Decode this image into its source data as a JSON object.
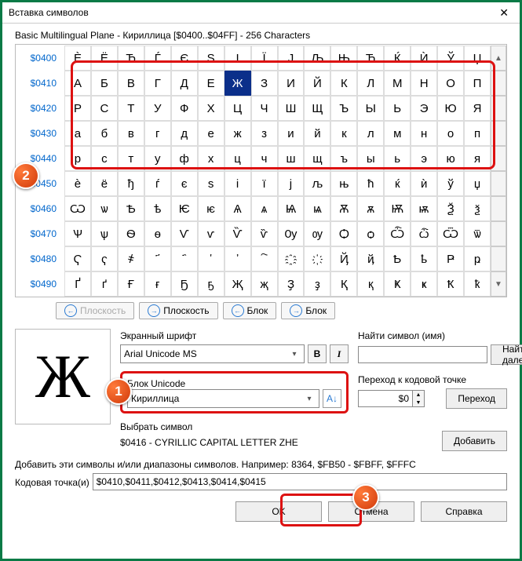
{
  "window": {
    "title": "Вставка символов"
  },
  "block_title": "Basic Multilingual Plane - Кириллица [$0400..$04FF] - 256 Characters",
  "rows": [
    {
      "label": "$0400",
      "chars": [
        "Ѐ",
        "Ё",
        "Ђ",
        "Ѓ",
        "Є",
        "Ѕ",
        "І",
        "Ї",
        "Ј",
        "Љ",
        "Њ",
        "Ћ",
        "Ќ",
        "Ѝ",
        "Ў",
        "Џ"
      ]
    },
    {
      "label": "$0410",
      "chars": [
        "А",
        "Б",
        "В",
        "Г",
        "Д",
        "Е",
        "Ж",
        "З",
        "И",
        "Й",
        "К",
        "Л",
        "М",
        "Н",
        "О",
        "П"
      ]
    },
    {
      "label": "$0420",
      "chars": [
        "Р",
        "С",
        "Т",
        "У",
        "Ф",
        "Х",
        "Ц",
        "Ч",
        "Ш",
        "Щ",
        "Ъ",
        "Ы",
        "Ь",
        "Э",
        "Ю",
        "Я"
      ]
    },
    {
      "label": "$0430",
      "chars": [
        "а",
        "б",
        "в",
        "г",
        "д",
        "е",
        "ж",
        "з",
        "и",
        "й",
        "к",
        "л",
        "м",
        "н",
        "о",
        "п"
      ]
    },
    {
      "label": "$0440",
      "chars": [
        "р",
        "с",
        "т",
        "у",
        "ф",
        "х",
        "ц",
        "ч",
        "ш",
        "щ",
        "ъ",
        "ы",
        "ь",
        "э",
        "ю",
        "я"
      ]
    },
    {
      "label": "$0450",
      "chars": [
        "ѐ",
        "ё",
        "ђ",
        "ѓ",
        "є",
        "ѕ",
        "і",
        "ї",
        "ј",
        "љ",
        "њ",
        "ћ",
        "ќ",
        "ѝ",
        "ў",
        "џ"
      ]
    },
    {
      "label": "$0460",
      "chars": [
        "Ѡ",
        "ѡ",
        "Ѣ",
        "ѣ",
        "Ѥ",
        "ѥ",
        "Ѧ",
        "ѧ",
        "Ѩ",
        "ѩ",
        "Ѫ",
        "ѫ",
        "Ѭ",
        "ѭ",
        "Ѯ",
        "ѯ"
      ]
    },
    {
      "label": "$0470",
      "chars": [
        "Ѱ",
        "ѱ",
        "Ѳ",
        "ѳ",
        "Ѵ",
        "ѵ",
        "Ѷ",
        "ѷ",
        "Ѹ",
        "ѹ",
        "Ѻ",
        "ѻ",
        "Ѽ",
        "ѽ",
        "Ѿ",
        "ѿ"
      ]
    },
    {
      "label": "$0480",
      "chars": [
        "Ҁ",
        "ҁ",
        "҂",
        "҃",
        "҄",
        "҅",
        "҆",
        "҇",
        "҈",
        "҉",
        "Ҋ",
        "ҋ",
        "Ҍ",
        "ҍ",
        "Ҏ",
        "ҏ"
      ]
    },
    {
      "label": "$0490",
      "chars": [
        "Ґ",
        "ґ",
        "Ғ",
        "ғ",
        "Ҕ",
        "ҕ",
        "Җ",
        "җ",
        "Ҙ",
        "ҙ",
        "Қ",
        "қ",
        "Ҝ",
        "ҝ",
        "Ҟ",
        "ҟ"
      ]
    }
  ],
  "selected": {
    "row": 1,
    "col": 6
  },
  "nav": {
    "plane_prev": "Плоскость",
    "plane_next": "Плоскость",
    "block_prev": "Блок",
    "block_next": "Блок"
  },
  "font": {
    "label": "Экранный шрифт",
    "value": "Arial Unicode MS",
    "bold": "B",
    "italic": "I"
  },
  "unicode_block": {
    "label": "Блок Unicode",
    "value": "Кириллица"
  },
  "selected_char": {
    "label": "Выбрать символ",
    "value": "$0416 - CYRILLIC CAPITAL LETTER ZHE",
    "glyph": "Ж"
  },
  "find": {
    "label": "Найти символ (имя)",
    "value": "",
    "button": "Найти далее"
  },
  "goto": {
    "label": "Переход к кодовой точке",
    "value": "$0",
    "button": "Переход"
  },
  "add_button": "Добавить",
  "help_line": "Добавить эти символы и/или диапазоны символов. Например: 8364, $FB50 - $FBFF, $FFFC",
  "codepoint": {
    "label": "Кодовая точка(и)",
    "value": "$0410,$0411,$0412,$0413,$0414,$0415"
  },
  "footer": {
    "ok": "OK",
    "cancel": "Отмена",
    "help": "Справка"
  },
  "badges": {
    "b1": "1",
    "b2": "2",
    "b3": "3"
  }
}
